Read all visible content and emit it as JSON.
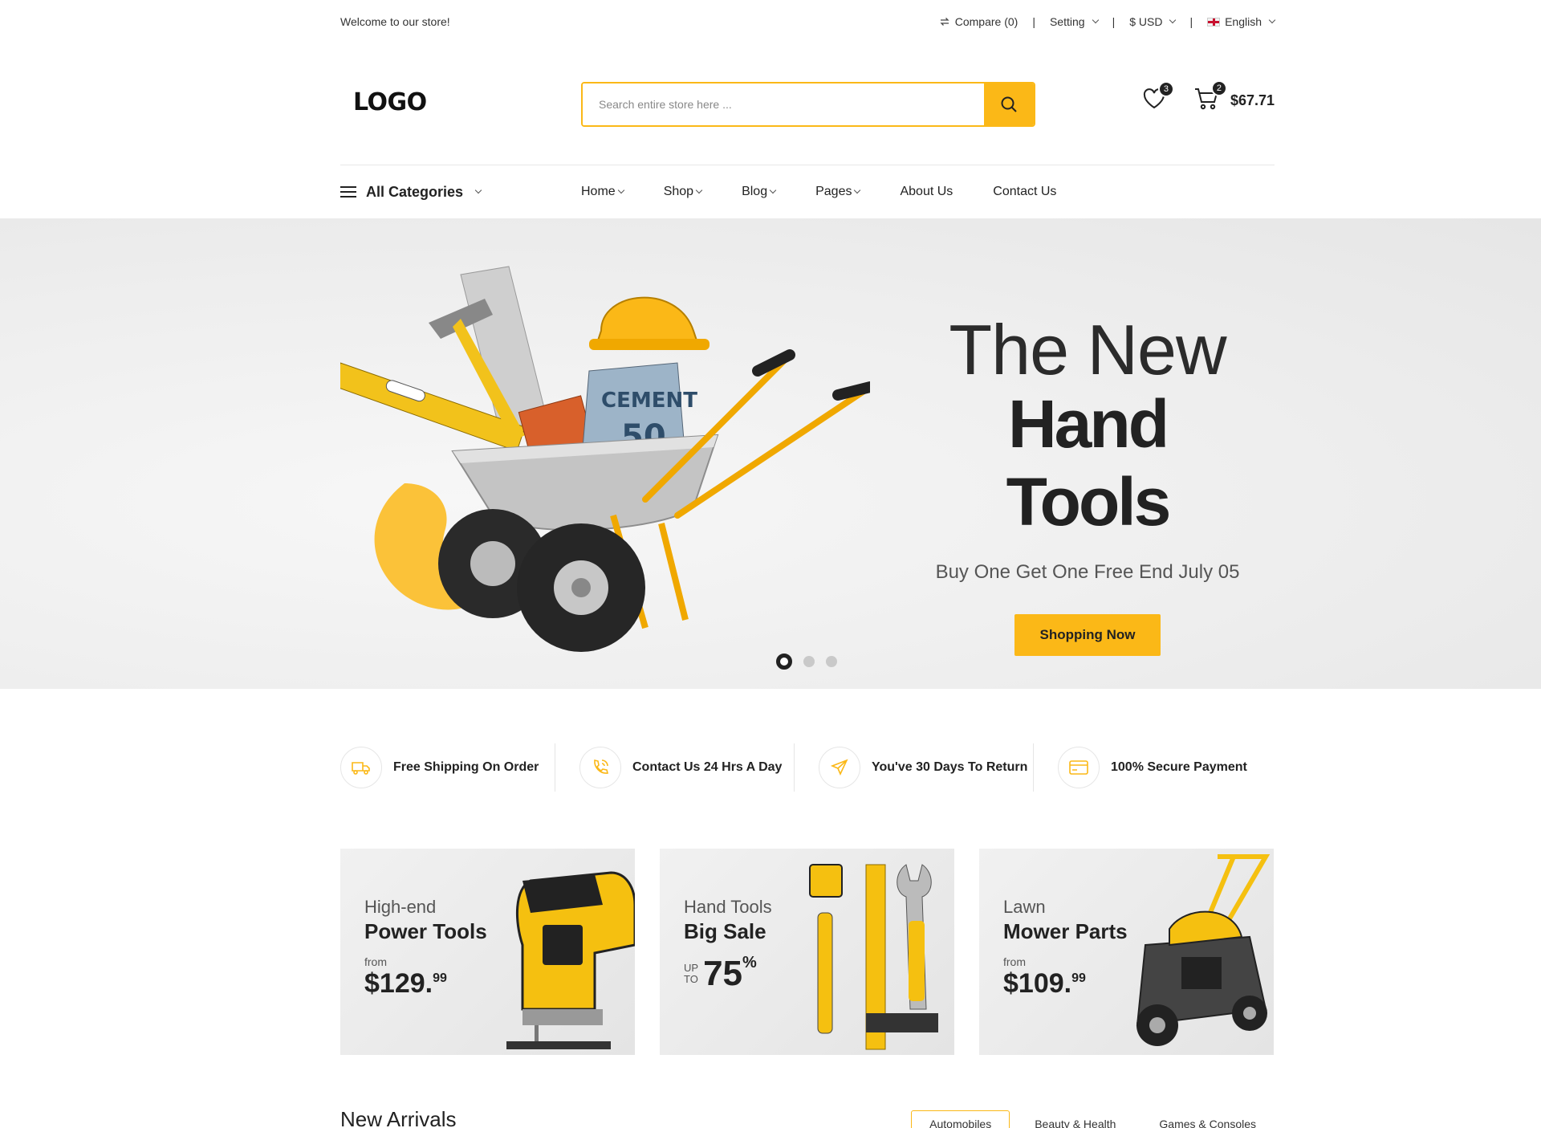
{
  "topbar": {
    "welcome": "Welcome to our store!",
    "compare": "Compare (0)",
    "setting": "Setting",
    "currency": "$ USD",
    "language": "English",
    "separator": "|"
  },
  "header": {
    "logo": "LOGO",
    "search_placeholder": "Search entire store here ...",
    "wishlist_count": "3",
    "cart_count": "2",
    "cart_total": "$67.71"
  },
  "nav": {
    "all_categories": "All Categories",
    "items": [
      {
        "label": "Home",
        "dropdown": true
      },
      {
        "label": "Shop",
        "dropdown": true
      },
      {
        "label": "Blog",
        "dropdown": true
      },
      {
        "label": "Pages",
        "dropdown": true
      },
      {
        "label": "About Us",
        "dropdown": false
      },
      {
        "label": "Contact Us",
        "dropdown": false
      }
    ]
  },
  "hero": {
    "line1": "The New",
    "line2": "Hand Tools",
    "subtitle": "Buy One Get One Free End July 05",
    "button": "Shopping Now",
    "slides": 3,
    "active_slide": 1
  },
  "features": [
    {
      "icon": "truck-icon",
      "label": "Free Shipping On Order"
    },
    {
      "icon": "phone-icon",
      "label": "Contact Us 24 Hrs A Day"
    },
    {
      "icon": "send-icon",
      "label": "You've 30 Days To Return"
    },
    {
      "icon": "card-icon",
      "label": "100% Secure Payment"
    }
  ],
  "banners": [
    {
      "pre": "High-end",
      "title": "Power Tools",
      "from": "from",
      "price_main": "$129.",
      "price_cents": "99"
    },
    {
      "pre": "Hand Tools",
      "title": "Big Sale",
      "upto_top": "UP",
      "upto_bottom": "TO",
      "upto_value": "75",
      "upto_unit": "%"
    },
    {
      "pre": "Lawn",
      "title": "Mower Parts",
      "from": "from",
      "price_main": "$109.",
      "price_cents": "99"
    }
  ],
  "arrivals": {
    "title": "New Arrivals",
    "tabs": [
      "Automobiles",
      "Beauty & Health",
      "Games & Consoles"
    ],
    "active_tab": 0
  },
  "colors": {
    "accent": "#fbb817",
    "text_dark": "#222222",
    "hero_bg": "#eeeeee"
  }
}
